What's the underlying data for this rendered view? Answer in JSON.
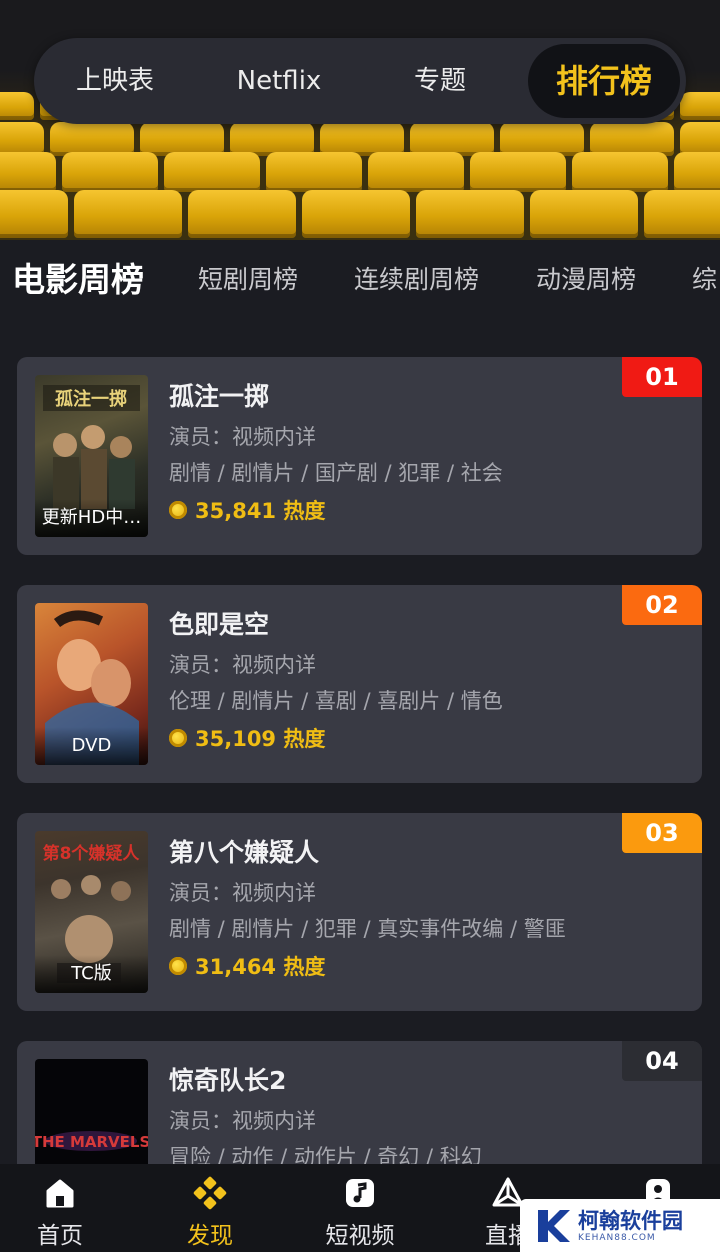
{
  "top_tabs": [
    "上映表",
    "Netflix",
    "专题",
    "排行榜"
  ],
  "category_tabs": [
    "电影周榜",
    "短剧周榜",
    "连续剧周榜",
    "动漫周榜",
    "综"
  ],
  "movies": [
    {
      "rank": "01",
      "title": "孤注一掷",
      "actors": "演员：视频内详",
      "genres": "剧情 / 剧情片 / 国产剧 / 犯罪 / 社会",
      "heat": "35,841 热度",
      "badge": "更新HD中…",
      "rank_color": "#f01a14"
    },
    {
      "rank": "02",
      "title": "色即是空",
      "actors": "演员：视频内详",
      "genres": "伦理 / 剧情片 / 喜剧 / 喜剧片 / 情色",
      "heat": "35,109 热度",
      "badge": "DVD",
      "rank_color": "#fb6a10"
    },
    {
      "rank": "03",
      "title": "第八个嫌疑人",
      "actors": "演员：视频内详",
      "genres": "剧情 / 剧情片 / 犯罪 / 真实事件改编 / 警匪",
      "heat": "31,464 热度",
      "badge": "TC版",
      "rank_color": "#fb9a0e"
    },
    {
      "rank": "04",
      "title": "惊奇队长2",
      "actors": "演员：视频内详",
      "genres": "冒险 / 动作 / 动作片 / 奇幻 / 科幻",
      "heat": "",
      "badge": "",
      "rank_color": "#2c2d33"
    }
  ],
  "bottom_nav": [
    "首页",
    "发现",
    "短视频",
    "直播",
    ""
  ],
  "watermark": {
    "name": "柯翰软件园",
    "url": "KEHAN88.COM"
  },
  "colors": {
    "accent": "#f3c21c",
    "background": "#1b1c22",
    "card": "#393a44"
  }
}
